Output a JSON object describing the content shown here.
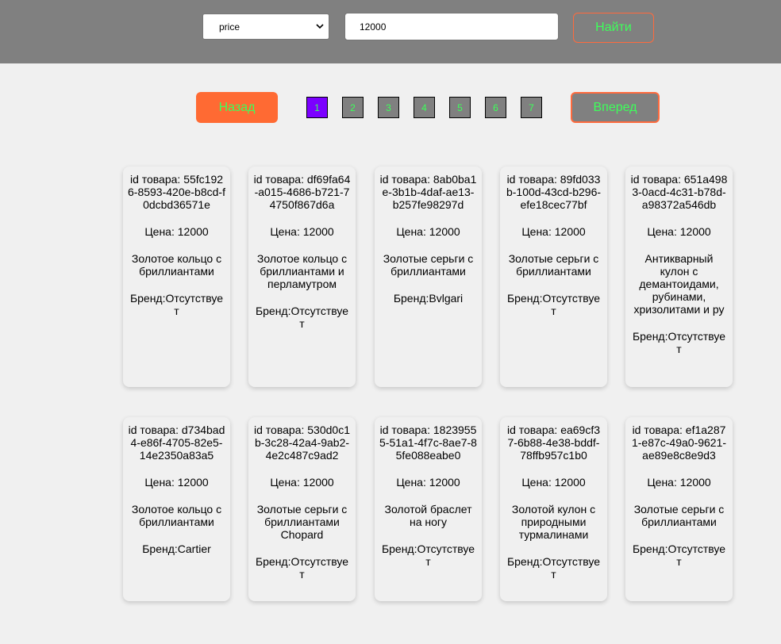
{
  "search": {
    "field_value": "price",
    "input_value": "12000",
    "find_label": "Найти"
  },
  "pagination": {
    "back_label": "Назад",
    "next_label": "Вперед",
    "pages": [
      "1",
      "2",
      "3",
      "4",
      "5",
      "6",
      "7"
    ],
    "active_page": "1"
  },
  "colors": {
    "topbar": "#808080",
    "accent_green": "#3dff5a",
    "accent_orange": "#ff6a33",
    "active_page": "#7b00ff"
  },
  "products": [
    {
      "id": "id товара: 55fc1926-8593-420e-b8cd-f0dcbd36571e",
      "price": "Цена: 12000",
      "name": "Золотое кольцо с бриллиантами",
      "brand": "Бренд:Отсутствует"
    },
    {
      "id": "id товара: df69fa64-a015-4686-b721-74750f867d6a",
      "price": "Цена: 12000",
      "name": "Золотое кольцо с бриллиантами и перламутром",
      "brand": "Бренд:Отсутствует"
    },
    {
      "id": "id товара: 8ab0ba1e-3b1b-4daf-ae13-b257fe98297d",
      "price": "Цена: 12000",
      "name": "Золотые серьги с бриллиантами",
      "brand": "Бренд:Bvlgari"
    },
    {
      "id": "id товара: 89fd033b-100d-43cd-b296-efe18cec77bf",
      "price": "Цена: 12000",
      "name": "Золотые серьги с бриллиантами",
      "brand": "Бренд:Отсутствует"
    },
    {
      "id": "id товара: 651a4983-0acd-4c31-b78d-a98372a546db",
      "price": "Цена: 12000",
      "name": "Антикварный кулон с демантоидами, рубинами, хризолитами и ру",
      "brand": "Бренд:Отсутствует"
    },
    {
      "id": "id товара: d734bad4-e86f-4705-82e5-14e2350a83a5",
      "price": "Цена: 12000",
      "name": "Золотое кольцо с бриллиантами",
      "brand": "Бренд:Cartier"
    },
    {
      "id": "id товара: 530d0c1b-3c28-42a4-9ab2-4e2c487c9ad2",
      "price": "Цена: 12000",
      "name": "Золотые серьги с бриллиантами Chopard",
      "brand": "Бренд:Отсутствует"
    },
    {
      "id": "id товара: 18239555-51a1-4f7c-8ae7-85fe088eabe0",
      "price": "Цена: 12000",
      "name": "Золотой браслет на ногу",
      "brand": "Бренд:Отсутствует"
    },
    {
      "id": "id товара: ea69cf37-6b88-4e38-bddf-78ffb957c1b0",
      "price": "Цена: 12000",
      "name": "Золотой кулон с природными турмалинами",
      "brand": "Бренд:Отсутствует"
    },
    {
      "id": "id товара: ef1a2871-e87c-49a0-9621-ae89e8c8e9d3",
      "price": "Цена: 12000",
      "name": "Золотые серьги с бриллиантами",
      "brand": "Бренд:Отсутствует"
    }
  ]
}
